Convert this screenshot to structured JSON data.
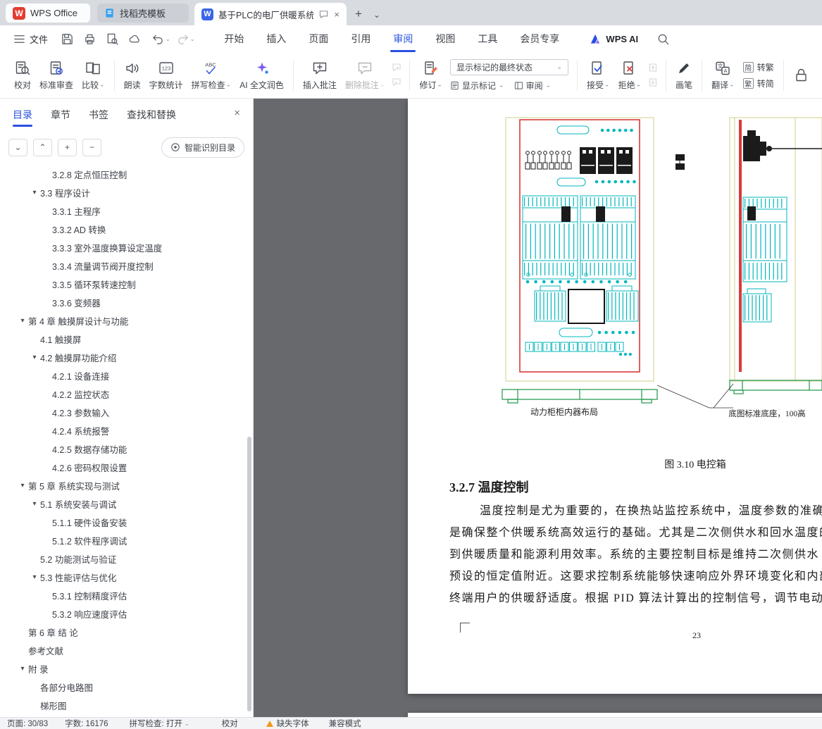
{
  "tabbar": {
    "wps_tab": "WPS Office",
    "template_tab": "找稻壳模板",
    "doc_tab": "基于PLC的电厂供暖系统的设",
    "wps_logo_letter": "W",
    "doc_icon_letter": "W"
  },
  "menubar": {
    "file": "文件",
    "tabs": [
      "开始",
      "插入",
      "页面",
      "引用",
      "审阅",
      "视图",
      "工具",
      "会员专享"
    ],
    "active_tab": "审阅",
    "wps_ai": "WPS AI"
  },
  "ribbon": {
    "proofread": "校对",
    "standard_review": "标准审查",
    "compare": "比较",
    "read_aloud": "朗读",
    "word_count": "字数统计",
    "spell_check": "拼写检查",
    "ai_polish": "AI 全文润色",
    "insert_comment": "插入批注",
    "delete_comment": "删除批注",
    "track_changes": "修订",
    "markup_state": "显示标记的最终状态",
    "show_markup": "显示标记",
    "review_pane": "审阅",
    "accept": "接受",
    "reject": "拒绝",
    "brush": "画笔",
    "translate": "翻译",
    "simp_char": "简",
    "to_traditional": "转繁",
    "trad_char": "繁",
    "to_simplified": "转简"
  },
  "sidebar": {
    "tabs": [
      "目录",
      "章节",
      "书签",
      "查找和替换"
    ],
    "active_tab": "目录",
    "smart_toc": "智能识别目录",
    "toc": [
      {
        "label": "3.2.8 定点恒压控制",
        "level": 3,
        "arrow": false
      },
      {
        "label": "3.3 程序设计",
        "level": 2,
        "arrow": true
      },
      {
        "label": "3.3.1 主程序",
        "level": 3,
        "arrow": false
      },
      {
        "label": "3.3.2 AD 转换",
        "level": 3,
        "arrow": false
      },
      {
        "label": "3.3.3 室外温度换算设定温度",
        "level": 3,
        "arrow": false
      },
      {
        "label": "3.3.4 流量调节阀开度控制",
        "level": 3,
        "arrow": false
      },
      {
        "label": "3.3.5 循环泵转速控制",
        "level": 3,
        "arrow": false
      },
      {
        "label": "3.3.6 变频器",
        "level": 3,
        "arrow": false
      },
      {
        "label": "第 4 章  触摸屏设计与功能",
        "level": 1,
        "arrow": true
      },
      {
        "label": "4.1 触摸屏",
        "level": 2,
        "arrow": false
      },
      {
        "label": "4.2 触摸屏功能介绍",
        "level": 2,
        "arrow": true
      },
      {
        "label": "4.2.1 设备连接",
        "level": 3,
        "arrow": false
      },
      {
        "label": "4.2.2 监控状态",
        "level": 3,
        "arrow": false
      },
      {
        "label": "4.2.3 参数输入",
        "level": 3,
        "arrow": false
      },
      {
        "label": "4.2.4 系统报警",
        "level": 3,
        "arrow": false
      },
      {
        "label": "4.2.5 数据存储功能",
        "level": 3,
        "arrow": false
      },
      {
        "label": "4.2.6 密码权限设置",
        "level": 3,
        "arrow": false
      },
      {
        "label": "第 5 章  系统实现与测试",
        "level": 1,
        "arrow": true
      },
      {
        "label": "5.1 系统安装与调试",
        "level": 2,
        "arrow": true
      },
      {
        "label": "5.1.1 硬件设备安装",
        "level": 3,
        "arrow": false
      },
      {
        "label": "5.1.2 软件程序调试",
        "level": 3,
        "arrow": false
      },
      {
        "label": "5.2 功能测试与验证",
        "level": 2,
        "arrow": false
      },
      {
        "label": "5.3 性能评估与优化",
        "level": 2,
        "arrow": true
      },
      {
        "label": "5.3.1 控制精度评估",
        "level": 3,
        "arrow": false
      },
      {
        "label": "5.3.2 响应速度评估",
        "level": 3,
        "arrow": false
      },
      {
        "label": "第 6 章  结 论",
        "level": 1,
        "arrow": false
      },
      {
        "label": "参考文献",
        "level": 1,
        "arrow": false
      },
      {
        "label": "附 录",
        "level": 1,
        "arrow": true
      },
      {
        "label": "各部分电路图",
        "level": 2,
        "arrow": false
      },
      {
        "label": "梯形图",
        "level": 2,
        "arrow": false
      }
    ]
  },
  "document": {
    "figure_caption_left": "动力柜柜内器布局",
    "figure_caption_right": "底图标准底座，100高",
    "figure_label": "图 3.10 电控箱",
    "heading": "3.2.7 温度控制",
    "paragraph_lines": [
      "温度控制是尤为重要的，在换热站监控系统中，温度参数的准确",
      "是确保整个供暖系统高效运行的基础。尤其是二次侧供水和回水温度的",
      "到供暖质量和能源利用效率。系统的主要控制目标是维持二次侧供水",
      "预设的恒定值附近。这要求控制系统能够快速响应外界环境变化和内部",
      "终端用户的供暖舒适度。根据 PID 算法计算出的控制信号，调节电动调"
    ],
    "page_number": "23"
  },
  "statusbar": {
    "page_info": "页面: 30/83",
    "word_count": "字数: 16176",
    "spell_check": "拼写检查: 打开",
    "proofread": "校对",
    "missing_font": "缺失字体",
    "compat_mode": "兼容模式"
  },
  "icons": {
    "caret": "⌄",
    "close": "×",
    "collapse_all": "⌄",
    "expand_all": "⌃",
    "plus": "+",
    "minus": "−",
    "new_tab": "+",
    "tab_list": "⌄",
    "toc_arrow": "▾"
  },
  "colors": {
    "accent": "#2a50e0",
    "wps_red": "#e23d33",
    "doc_icon_blue": "#3a66e8",
    "cad_cyan": "#00b7bd",
    "cad_red": "#d93a3a",
    "cad_green": "#2f9e56",
    "cad_frame": "#cfd08a",
    "warning": "#f09a1d"
  }
}
